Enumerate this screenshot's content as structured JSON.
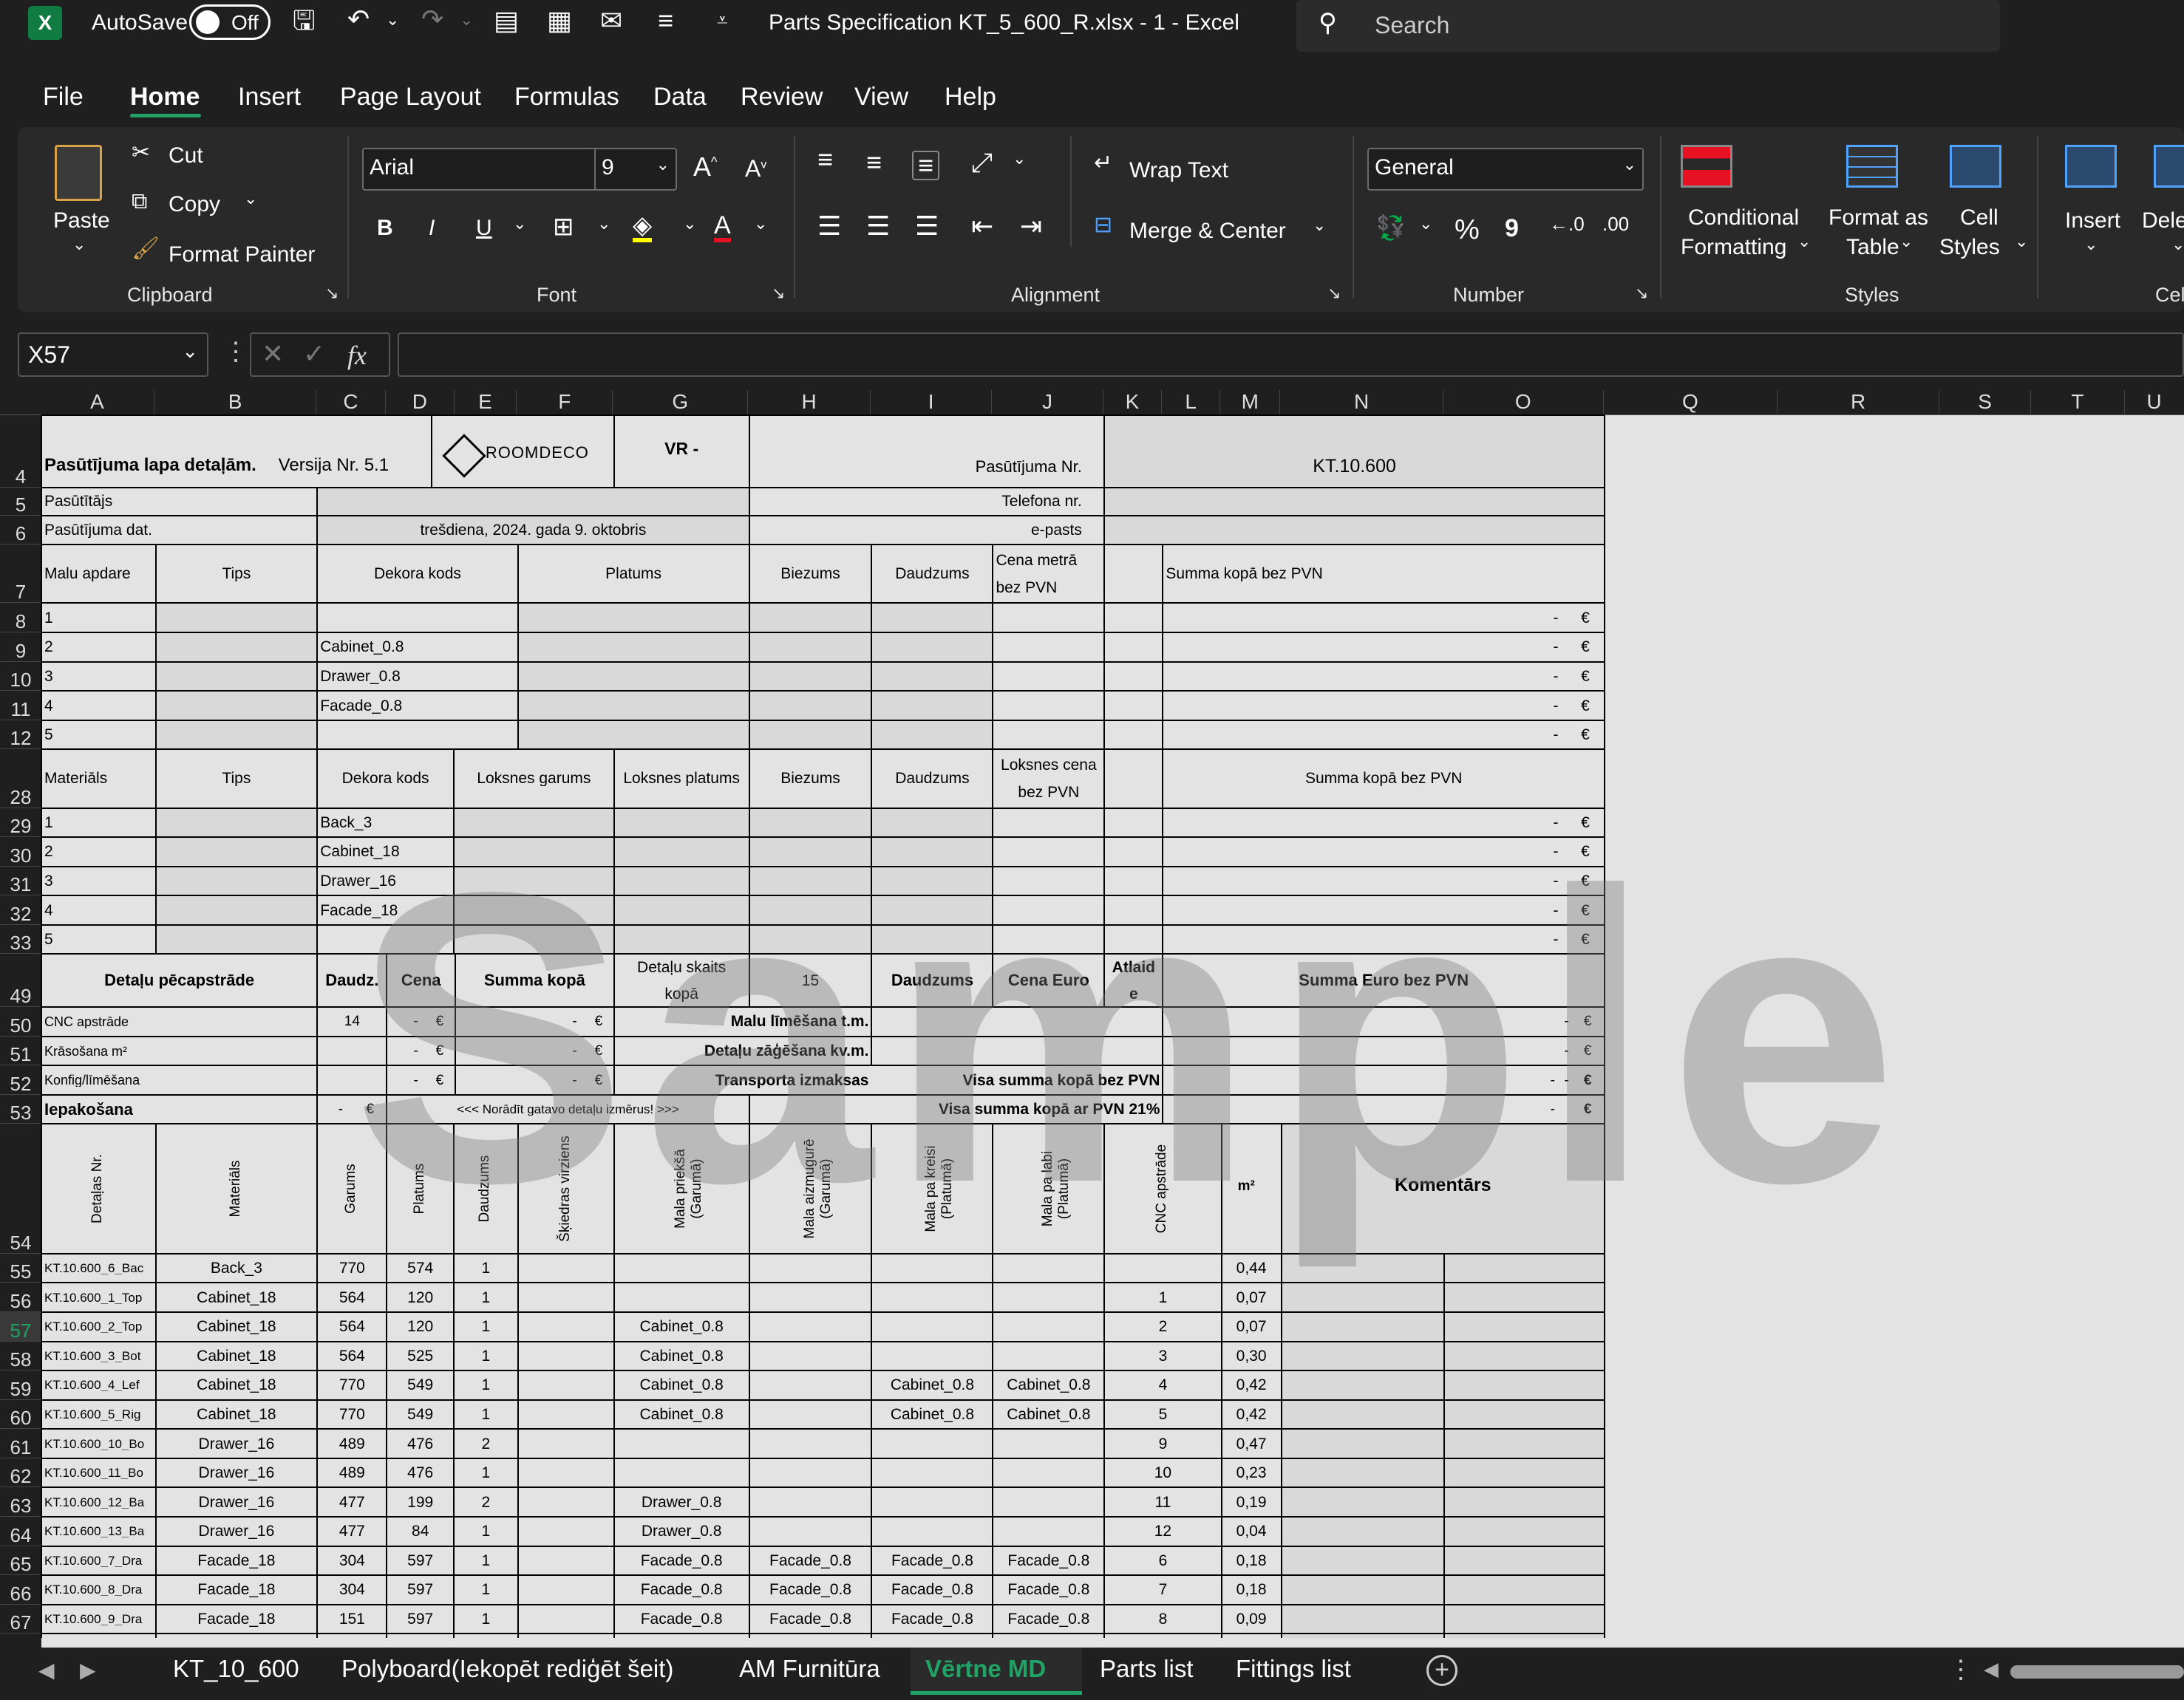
{
  "titlebar": {
    "autosave_label": "AutoSave",
    "autosave_state": "Off",
    "file_title": "Parts  Specification KT_5_600_R.xlsx  -  1  -  Excel",
    "search_placeholder": "Search"
  },
  "menu_tabs": [
    "File",
    "Home",
    "Insert",
    "Page Layout",
    "Formulas",
    "Data",
    "Review",
    "View",
    "Help"
  ],
  "ribbon": {
    "clipboard": {
      "paste": "Paste",
      "cut": "Cut",
      "copy": "Copy",
      "format_painter": "Format Painter",
      "group": "Clipboard"
    },
    "font": {
      "name": "Arial",
      "size": "9",
      "group": "Font",
      "bold": "B",
      "italic": "I",
      "underline": "U"
    },
    "alignment": {
      "wrap": "Wrap Text",
      "merge": "Merge & Center",
      "group": "Alignment"
    },
    "number": {
      "format": "General",
      "group": "Number",
      "percent": "%",
      "comma": "9"
    },
    "styles": {
      "conditional_1": "Conditional",
      "conditional_2": "Formatting",
      "format_table_1": "Format as",
      "format_table_2": "Table",
      "cell_styles_1": "Cell",
      "cell_styles_2": "Styles",
      "group": "Styles"
    },
    "cells": {
      "insert": "Insert",
      "delete": "Dele",
      "group": "Cel"
    }
  },
  "formula_bar": {
    "name_box": "X57",
    "fx": "fx"
  },
  "columns": [
    "A",
    "B",
    "C",
    "D",
    "E",
    "F",
    "G",
    "H",
    "I",
    "J",
    "K",
    "L",
    "M",
    "N",
    "O",
    "Q",
    "R",
    "S",
    "T",
    "U"
  ],
  "row_numbers": [
    "4",
    "5",
    "6",
    "7",
    "8",
    "9",
    "10",
    "11",
    "12",
    "28",
    "29",
    "30",
    "31",
    "32",
    "33",
    "49",
    "50",
    "51",
    "52",
    "53",
    "54",
    "55",
    "56",
    "57",
    "58",
    "59",
    "60",
    "61",
    "62",
    "63",
    "64",
    "65",
    "66",
    "67"
  ],
  "sheet": {
    "header": {
      "title": "Pasūtījuma lapa  detaļām.",
      "version": "Versija Nr. 5.1",
      "logo": "ROOMDECO",
      "vr": "VR -",
      "order_no_label": "Pasūtījuma Nr.",
      "order_no": "KT.10.600",
      "customer_label": "Pasūtītājs",
      "phone_label": "Telefona nr.",
      "date_label": "Pasūtījuma dat.",
      "date": "trešdiena, 2024. gada 9. oktobris",
      "email_label": "e-pasts"
    },
    "edge_section": {
      "headers": [
        "Malu apdare",
        "Tips",
        "Dekora kods",
        "Platums",
        "Biezums",
        "Daudzums",
        "Cena metrā",
        "bez PVN",
        "Summa kopā bez PVN"
      ],
      "rows": [
        {
          "n": "1",
          "code": ""
        },
        {
          "n": "2",
          "code": "Cabinet_0.8"
        },
        {
          "n": "3",
          "code": "Drawer_0.8"
        },
        {
          "n": "4",
          "code": "Facade_0.8"
        },
        {
          "n": "5",
          "code": ""
        }
      ],
      "dash": "-",
      "euro": "€"
    },
    "material_section": {
      "headers": [
        "Materiāls",
        "Tips",
        "Dekora kods",
        "Loksnes garums",
        "Loksnes platums",
        "Biezums",
        "Daudzums",
        "Loksnes cena",
        "bez PVN",
        "Summa kopā bez PVN"
      ],
      "rows": [
        {
          "n": "1",
          "code": "Back_3"
        },
        {
          "n": "2",
          "code": "Cabinet_18"
        },
        {
          "n": "3",
          "code": "Drawer_16"
        },
        {
          "n": "4",
          "code": "Facade_18"
        },
        {
          "n": "5",
          "code": ""
        }
      ]
    },
    "processing": {
      "h_title": "Detaļu pēcapstrāde",
      "h_qty": "Daudz.",
      "h_price": "Cena",
      "h_sum": "Summa kopā",
      "h_parts_1": "Detaļu skaits",
      "h_parts_2": "kopā",
      "parts_count": "15",
      "h_qty2": "Daudzums",
      "h_price_eur": "Cena Euro",
      "h_disc_1": "Atlaid",
      "h_disc_2": "e",
      "h_total": "Summa Euro bez PVN",
      "cnc": "CNC apstrāde",
      "cnc_qty": "14",
      "painting": "Krāsošana m²",
      "konfig": "Konfig/līmēšana",
      "packing": "Iepakošana",
      "note": "<<< Norādīt gatavo detaļu izmērus!  >>>",
      "edge_glue": "Malu līmēšana t.m.",
      "cutting": "Detaļu zāģēšana  kv.m.",
      "transport": "Transporta izmaksas",
      "total_no_vat": "Visa summa kopā bez PVN",
      "total_vat": "Visa summa kopā ar PVN 21%"
    },
    "parts_headers": [
      "Detaļas Nr.",
      "Materiāls",
      "Garums",
      "Platums",
      "Daudzums",
      "Šķiedras virziens",
      "Mala priekšā (Garumā)",
      "Mala aizmugurē (Garumā)",
      "Mala pa kreisi (Platumā)",
      "Mala pa labi (Platumā)",
      "CNC apstrāde",
      "m²",
      "Komentārs"
    ],
    "parts": [
      {
        "id": "KT.10.600_6_Bac",
        "mat": "Back_3",
        "len": "770",
        "wid": "574",
        "qty": "1",
        "front": "",
        "back": "",
        "left": "",
        "right": "",
        "cnc": "",
        "m2": "0,44"
      },
      {
        "id": "KT.10.600_1_Top",
        "mat": "Cabinet_18",
        "len": "564",
        "wid": "120",
        "qty": "1",
        "front": "",
        "back": "",
        "left": "",
        "right": "",
        "cnc": "1",
        "m2": "0,07"
      },
      {
        "id": "KT.10.600_2_Top",
        "mat": "Cabinet_18",
        "len": "564",
        "wid": "120",
        "qty": "1",
        "front": "Cabinet_0.8",
        "back": "",
        "left": "",
        "right": "",
        "cnc": "2",
        "m2": "0,07"
      },
      {
        "id": "KT.10.600_3_Bot",
        "mat": "Cabinet_18",
        "len": "564",
        "wid": "525",
        "qty": "1",
        "front": "Cabinet_0.8",
        "back": "",
        "left": "",
        "right": "",
        "cnc": "3",
        "m2": "0,30"
      },
      {
        "id": "KT.10.600_4_Lef",
        "mat": "Cabinet_18",
        "len": "770",
        "wid": "549",
        "qty": "1",
        "front": "Cabinet_0.8",
        "back": "",
        "left": "Cabinet_0.8",
        "right": "Cabinet_0.8",
        "cnc": "4",
        "m2": "0,42"
      },
      {
        "id": "KT.10.600_5_Rig",
        "mat": "Cabinet_18",
        "len": "770",
        "wid": "549",
        "qty": "1",
        "front": "Cabinet_0.8",
        "back": "",
        "left": "Cabinet_0.8",
        "right": "Cabinet_0.8",
        "cnc": "5",
        "m2": "0,42"
      },
      {
        "id": "KT.10.600_10_Bo",
        "mat": "Drawer_16",
        "len": "489",
        "wid": "476",
        "qty": "2",
        "front": "",
        "back": "",
        "left": "",
        "right": "",
        "cnc": "9",
        "m2": "0,47"
      },
      {
        "id": "KT.10.600_11_Bo",
        "mat": "Drawer_16",
        "len": "489",
        "wid": "476",
        "qty": "1",
        "front": "",
        "back": "",
        "left": "",
        "right": "",
        "cnc": "10",
        "m2": "0,23"
      },
      {
        "id": "KT.10.600_12_Ba",
        "mat": "Drawer_16",
        "len": "477",
        "wid": "199",
        "qty": "2",
        "front": "Drawer_0.8",
        "back": "",
        "left": "",
        "right": "",
        "cnc": "11",
        "m2": "0,19"
      },
      {
        "id": "KT.10.600_13_Ba",
        "mat": "Drawer_16",
        "len": "477",
        "wid": "84",
        "qty": "1",
        "front": "Drawer_0.8",
        "back": "",
        "left": "",
        "right": "",
        "cnc": "12",
        "m2": "0,04"
      },
      {
        "id": "KT.10.600_7_Dra",
        "mat": "Facade_18",
        "len": "304",
        "wid": "597",
        "qty": "1",
        "front": "Facade_0.8",
        "back": "Facade_0.8",
        "left": "Facade_0.8",
        "right": "Facade_0.8",
        "cnc": "6",
        "m2": "0,18"
      },
      {
        "id": "KT.10.600_8_Dra",
        "mat": "Facade_18",
        "len": "304",
        "wid": "597",
        "qty": "1",
        "front": "Facade_0.8",
        "back": "Facade_0.8",
        "left": "Facade_0.8",
        "right": "Facade_0.8",
        "cnc": "7",
        "m2": "0,18"
      },
      {
        "id": "KT.10.600_9_Dra",
        "mat": "Facade_18",
        "len": "151",
        "wid": "597",
        "qty": "1",
        "front": "Facade_0.8",
        "back": "Facade_0.8",
        "left": "Facade_0.8",
        "right": "Facade_0.8",
        "cnc": "8",
        "m2": "0,09"
      }
    ],
    "watermark": "Sample"
  },
  "sheet_tabs": [
    "KT_10_600",
    "Polyboard(Iekopēt rediģēt šeit)",
    "AM Furnitūra",
    "Vērtne  MD",
    "Parts list",
    "Fittings list"
  ],
  "active_sheet": "Vērtne  MD",
  "colors": {
    "accent": "#21a366",
    "dark_bg": "#1f1f1f",
    "ribbon_bg": "#292929",
    "gray_fill": "#d9d9d9"
  }
}
